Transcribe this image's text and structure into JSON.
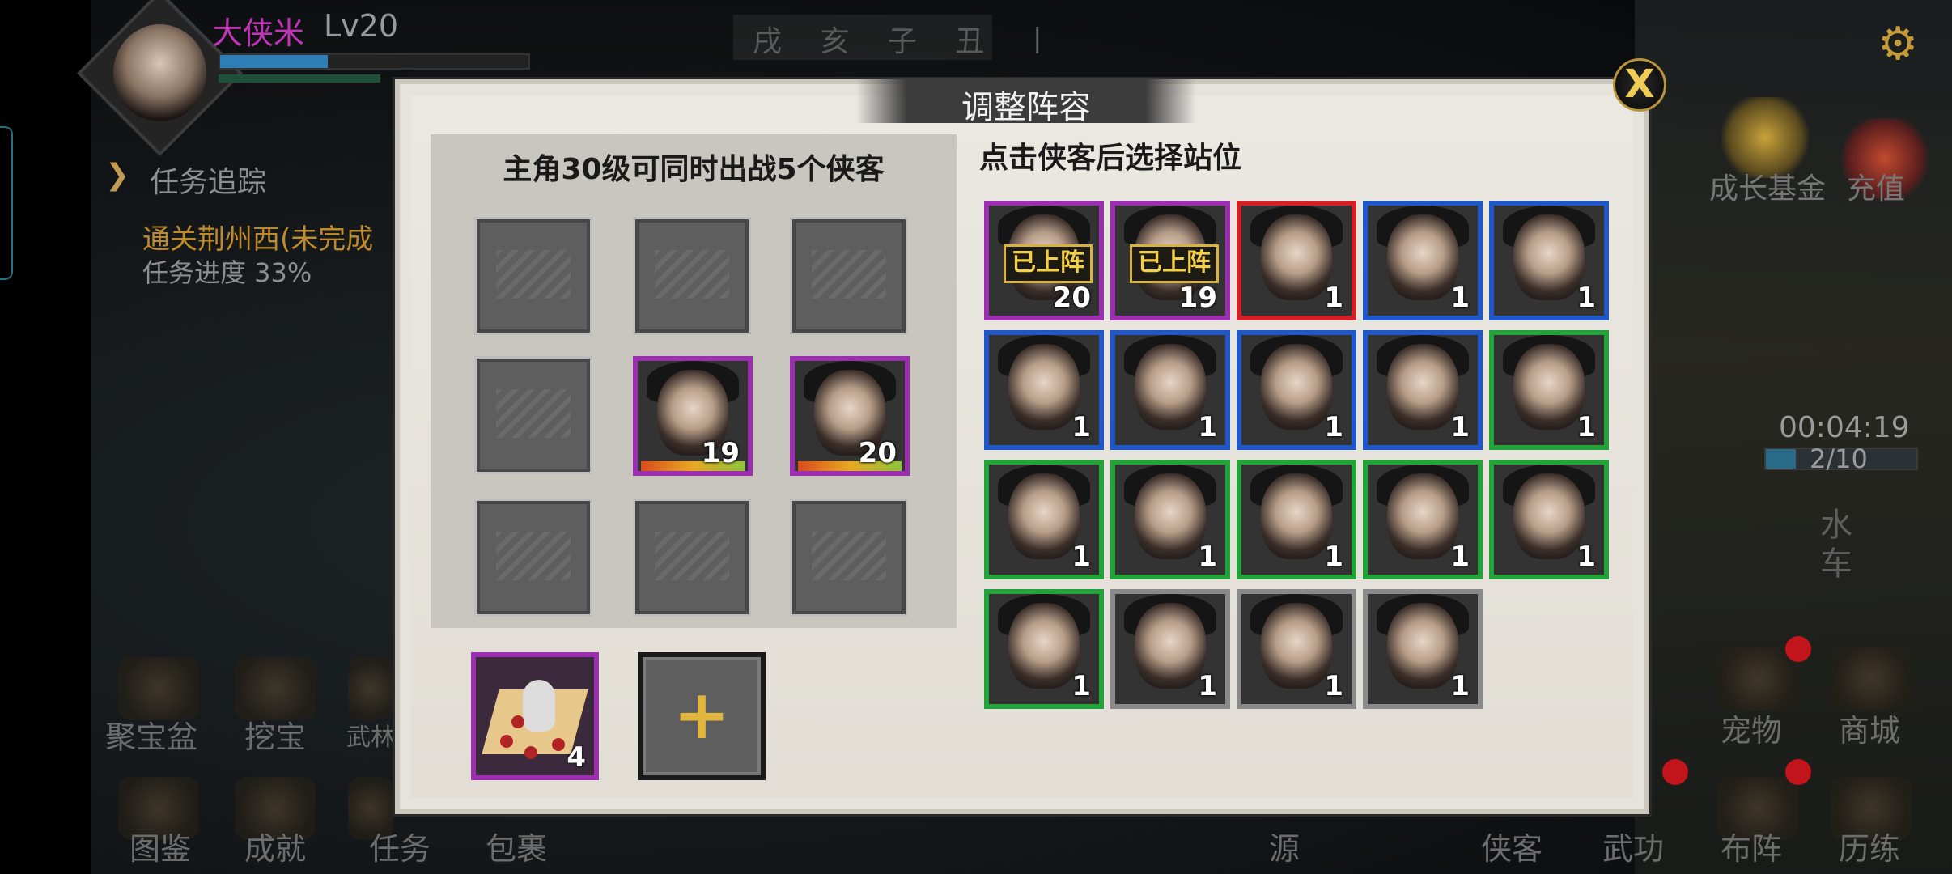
{
  "player": {
    "name": "大侠米",
    "level": "Lv20"
  },
  "top_center": "戌 亥 子 丑 丨",
  "quest": {
    "title": "任务追踪",
    "name": "通关荆州西(未完成",
    "progress": "任务进度 33%"
  },
  "timer": {
    "time": "00:04:19",
    "count": "2/10"
  },
  "side_label": "水车",
  "right_top_buttons": [
    "成长基金",
    "充值"
  ],
  "bottom_left_buttons_row1": [
    "聚宝盆",
    "挖宝",
    "武林"
  ],
  "bottom_left_buttons_row2": [
    "图鉴",
    "成就",
    "任务",
    "包裹"
  ],
  "bottom_center": "源",
  "bottom_right_buttons_row1": [
    "宠物",
    "商城"
  ],
  "bottom_right_buttons_row2": [
    "侠客",
    "武功",
    "布阵",
    "历练"
  ],
  "modal": {
    "title": "调整阵容",
    "close_label": "X",
    "formation_hint": "主角30级可同时出战5个侠客",
    "pick_hint": "点击侠客后选择站位",
    "formation_slots": [
      {
        "row": 2,
        "col": 2,
        "level": "19",
        "quality": "purple"
      },
      {
        "row": 2,
        "col": 3,
        "level": "20",
        "quality": "purple"
      }
    ],
    "item": {
      "count": "4"
    },
    "add_label": "+",
    "deployed_badge": "已上阵",
    "heroes": [
      {
        "level": "20",
        "quality": "purple",
        "deployed": true
      },
      {
        "level": "19",
        "quality": "purple",
        "deployed": true
      },
      {
        "level": "1",
        "quality": "red"
      },
      {
        "level": "1",
        "quality": "blue"
      },
      {
        "level": "1",
        "quality": "blue"
      },
      {
        "level": "1",
        "quality": "blue"
      },
      {
        "level": "1",
        "quality": "blue"
      },
      {
        "level": "1",
        "quality": "blue"
      },
      {
        "level": "1",
        "quality": "blue"
      },
      {
        "level": "1",
        "quality": "green"
      },
      {
        "level": "1",
        "quality": "green"
      },
      {
        "level": "1",
        "quality": "green"
      },
      {
        "level": "1",
        "quality": "green"
      },
      {
        "level": "1",
        "quality": "green"
      },
      {
        "level": "1",
        "quality": "green"
      },
      {
        "level": "1",
        "quality": "green"
      },
      {
        "level": "1",
        "quality": "grey"
      },
      {
        "level": "1",
        "quality": "grey"
      },
      {
        "level": "1",
        "quality": "grey"
      }
    ]
  },
  "colors": {
    "purple": "#9b2fb0",
    "red": "#d1202a",
    "blue": "#1f57c7",
    "green": "#23a23a",
    "grey": "#8a8a8a",
    "name": "#c233b8",
    "quest_gold": "#bf8a2c"
  }
}
